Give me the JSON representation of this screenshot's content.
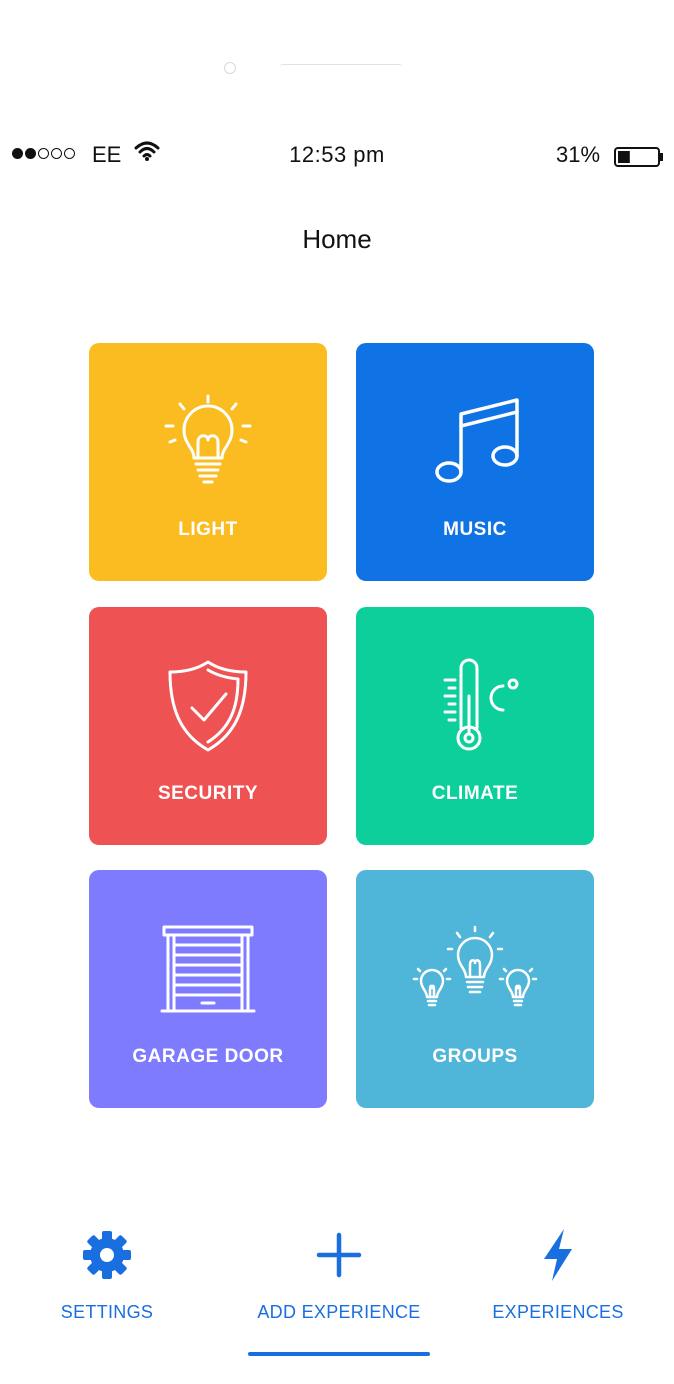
{
  "status_bar": {
    "carrier": "EE",
    "time": "12:53 pm",
    "battery": "31%",
    "signal_dots": [
      true,
      true,
      false,
      false,
      false
    ],
    "battery_level": 0.31
  },
  "header": {
    "title": "Home"
  },
  "tiles": [
    {
      "label": "LIGHT",
      "icon": "light-bulb-icon",
      "color": "#fbbc22"
    },
    {
      "label": "MUSIC",
      "icon": "music-note-icon",
      "color": "#0f72e5"
    },
    {
      "label": "SECURITY",
      "icon": "shield-check-icon",
      "color": "#ee5252"
    },
    {
      "label": "CLIMATE",
      "icon": "thermometer-icon",
      "color": "#0ccf9b"
    },
    {
      "label": "GARAGE DOOR",
      "icon": "garage-door-icon",
      "color": "#7f7bff"
    },
    {
      "label": "GROUPS",
      "icon": "light-bulbs-group-icon",
      "color": "#4fb6d9"
    }
  ],
  "tabbar": {
    "settings": "SETTINGS",
    "add_experience": "ADD EXPERIENCE",
    "experiences": "EXPERIENCES",
    "active": "ADD EXPERIENCE",
    "accent_color": "#1a6fe0"
  }
}
